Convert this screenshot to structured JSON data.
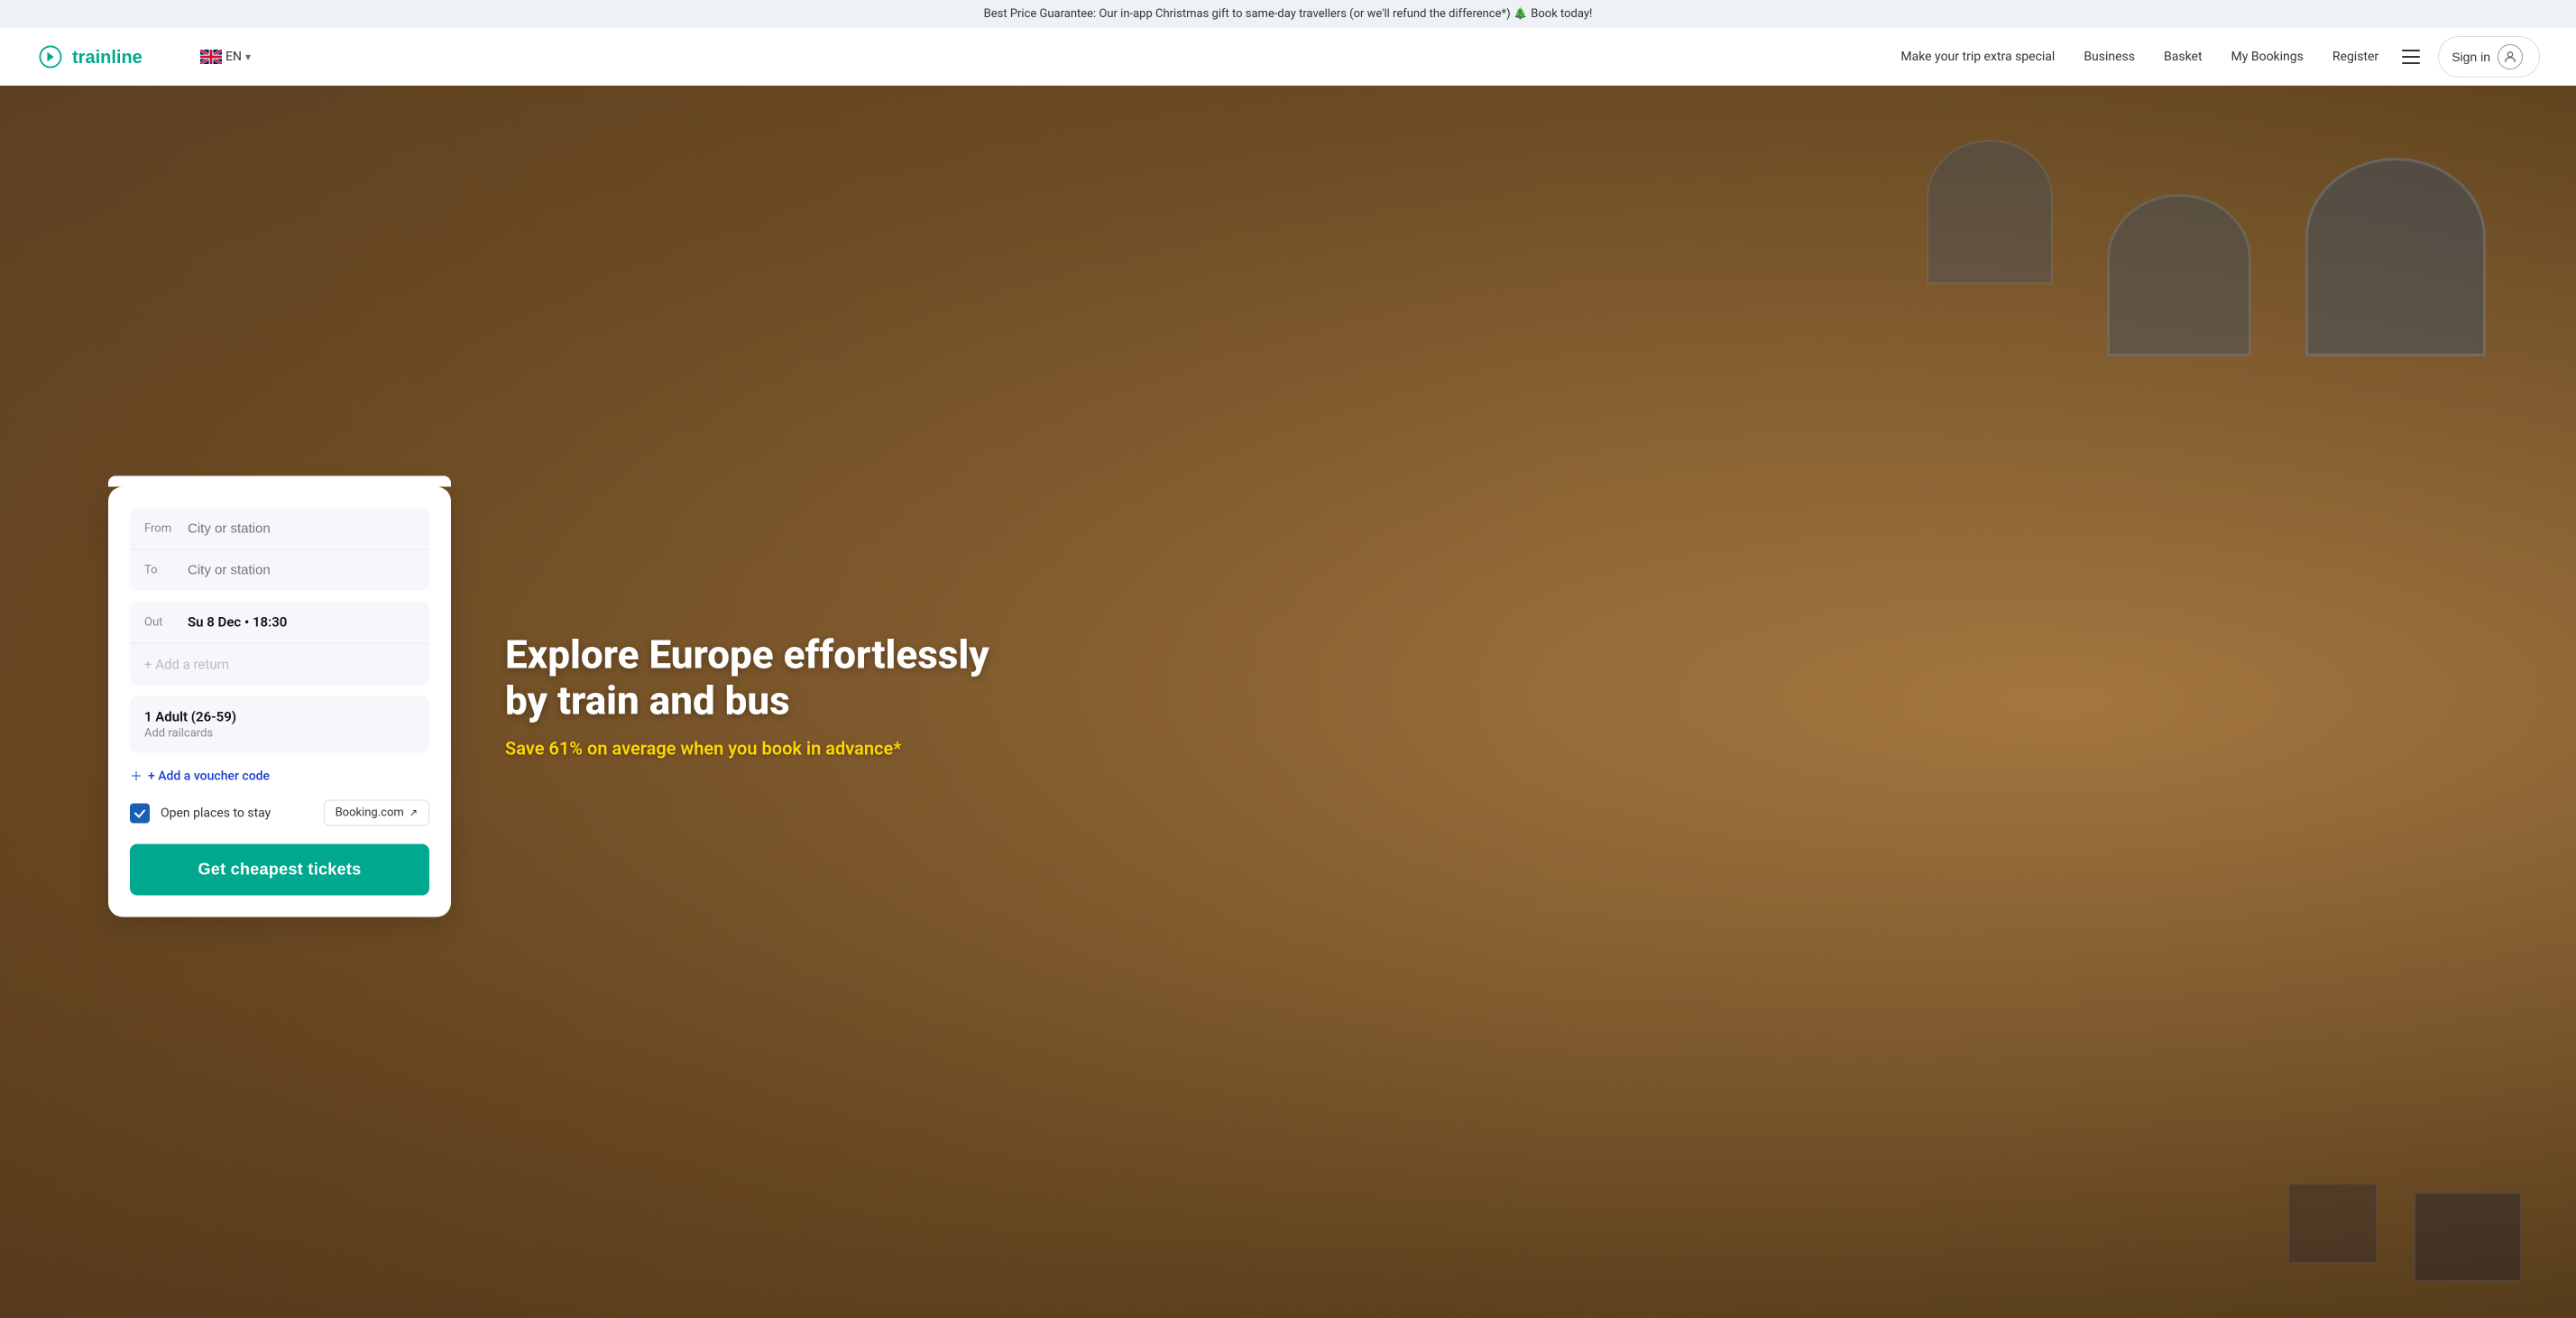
{
  "banner": {
    "text": "Best Price Guarantee: Our in-app Christmas gift to same-day travellers (or we'll refund the difference*)  🎄 Book today!"
  },
  "header": {
    "logo_text": "trainline",
    "lang_code": "EN",
    "nav_items": [
      {
        "id": "make-trip",
        "label": "Make your trip extra special"
      },
      {
        "id": "business",
        "label": "Business"
      },
      {
        "id": "basket",
        "label": "Basket"
      },
      {
        "id": "my-bookings",
        "label": "My Bookings"
      },
      {
        "id": "register",
        "label": "Register"
      }
    ],
    "sign_in_label": "Sign in"
  },
  "search_card": {
    "from_label": "From",
    "from_placeholder": "City or station",
    "to_label": "To",
    "to_placeholder": "City or station",
    "out_label": "Out",
    "out_value": "Su 8 Dec • 18:30",
    "return_placeholder": "+ Add a return",
    "passengers_main": "1 Adult (26-59)",
    "passengers_sub": "Add railcards",
    "voucher_label": "+ Add a voucher code",
    "open_places_label": "Open places to stay",
    "booking_badge_label": "Booking.com",
    "cta_label": "Get cheapest tickets"
  },
  "hero": {
    "headline": "Explore Europe effortlessly by train and bus",
    "subheadline": "Save 61% on average when you book in advance*"
  }
}
